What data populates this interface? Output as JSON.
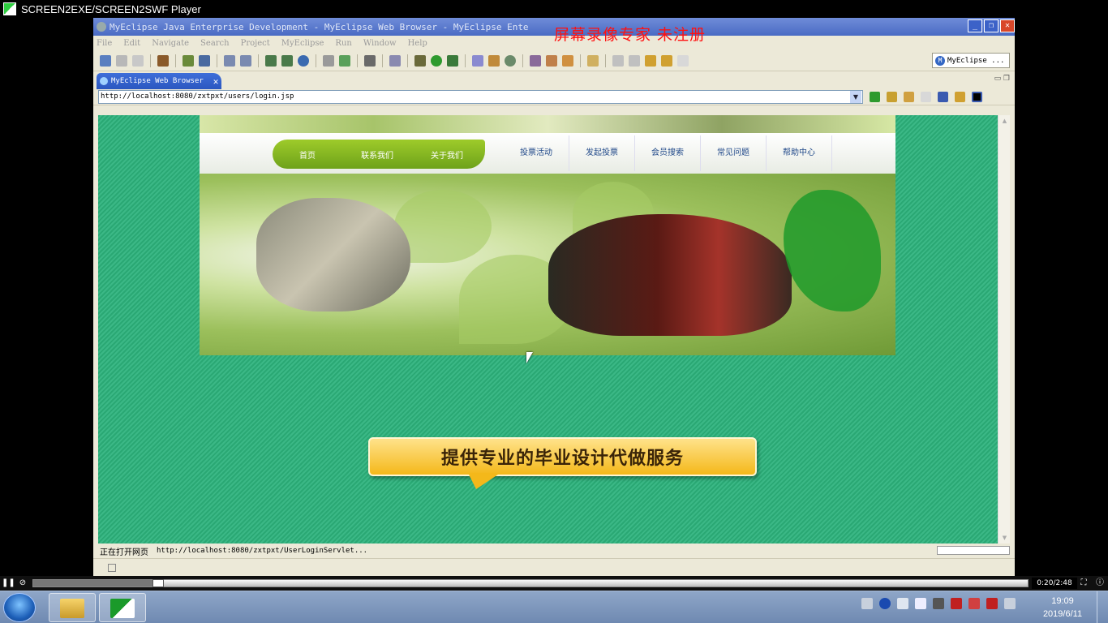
{
  "player": {
    "title": "SCREEN2EXE/SCREEN2SWF Player",
    "time": "0:20/2:48",
    "progress_fraction": 0.12
  },
  "eclipse": {
    "title": "MyEclipse Java Enterprise Development - MyEclipse Web Browser - MyEclipse Ente",
    "watermark": "屏幕录像专家  未注册",
    "menu": [
      "File",
      "Edit",
      "Navigate",
      "Search",
      "Project",
      "MyEclipse",
      "Run",
      "Window",
      "Help"
    ],
    "perspective": "MyEclipse ...",
    "tab_label": "MyEclipse Web Browser",
    "url": "http://localhost:8080/zxtpxt/users/login.jsp",
    "status_text": "正在打开网页",
    "status_url": "http://localhost:8080/zxtpxt/UserLoginServlet..."
  },
  "site": {
    "nav_green": [
      "首页",
      "联系我们",
      "关于我们"
    ],
    "nav_white": [
      "投票活动",
      "发起投票",
      "会员搜索",
      "常见问题",
      "帮助中心"
    ],
    "ad_text": "提供专业的毕业设计代做服务"
  },
  "taskbar": {
    "time": "19:09",
    "date": "2019/6/11"
  },
  "colors": {
    "page_bg": "#2aa874",
    "nav_green": "#8fbf26",
    "watermark": "#ff1010"
  }
}
